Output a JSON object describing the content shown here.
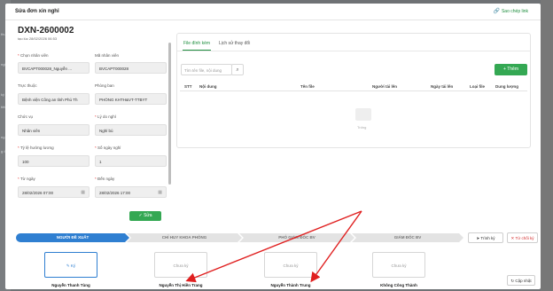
{
  "background": {
    "side_labels": [
      "thư",
      "ngh",
      "ký",
      "tiếu",
      "ng v",
      "g đồ"
    ]
  },
  "modal": {
    "title": "Sửa đơn xin nghỉ",
    "copy_link": "Sao chép link"
  },
  "form": {
    "doc_code": "DXN-2600002",
    "created": "tạo lúc 28/02/2026 06:53",
    "fields": {
      "employee": {
        "label": "Chọn nhân viên",
        "value": "BVCAPT000028_Nguyễn ..."
      },
      "employee_code": {
        "label": "Mã nhân viên",
        "value": "BVCAPT000028"
      },
      "unit": {
        "label": "Trực thuộc",
        "value": "Bệnh viện Công an tỉnh Phú Th"
      },
      "department": {
        "label": "Phòng ban",
        "value": "PHÒNG KHTH&VT-TTBYT"
      },
      "position": {
        "label": "Chức vụ",
        "value": "Nhân viên"
      },
      "reason": {
        "label": "Lý do nghỉ",
        "value": "Nghỉ bù"
      },
      "salary_rate": {
        "label": "Tỷ lệ hưởng lương",
        "value": "100"
      },
      "days": {
        "label": "Số ngày nghỉ",
        "value": "1"
      },
      "from": {
        "label": "Từ ngày",
        "value": "28/02/2026 07:00"
      },
      "to": {
        "label": "Đến ngày",
        "value": "28/02/2026 17:00"
      }
    },
    "save_label": "Sửa"
  },
  "attachments": {
    "tabs": [
      "File đính kèm",
      "Lịch sử thay đổi"
    ],
    "search_placeholder": "Tìm tên file, nội dung",
    "add_label": "Thêm",
    "columns": [
      "STT",
      "Nội dung",
      "Tên file",
      "Người tải lên",
      "Ngày tải lên",
      "Loại file",
      "Dung lượng"
    ],
    "empty_text": "Trống"
  },
  "workflow": {
    "steps": [
      "NGƯỜI ĐỀ XUẤT",
      "CHỈ HUY KHOA PHÒNG",
      "PHÓ GIÁM ĐỐC BV",
      "GIÁM ĐỐC BV"
    ],
    "submit_label": "Trình ký",
    "reject_label": "Từ chối ký",
    "update_label": "Cập nhật",
    "signatures": [
      {
        "status": "Ký",
        "name": "Nguyễn Thanh Tùng"
      },
      {
        "status": "Chưa ký",
        "name": "Nguyễn Thị Hiền Trang"
      },
      {
        "status": "Chưa ký",
        "name": "Nguyễn Thành Trung"
      },
      {
        "status": "Chưa ký",
        "name": "Không Công Thành"
      }
    ]
  },
  "colors": {
    "accent": "#1e8e3e",
    "primary": "#2f7fd1",
    "annotation": "#e02020"
  }
}
